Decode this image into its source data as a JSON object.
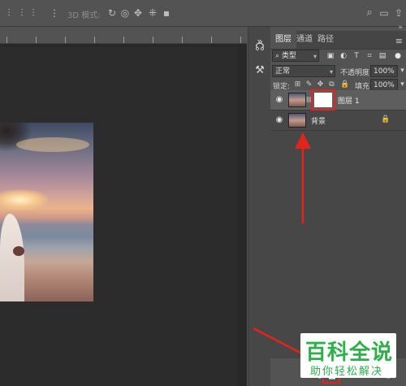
{
  "options_bar": {
    "mode_label": "3D 模式:"
  },
  "panel": {
    "tabs": [
      {
        "label": "图层",
        "active": true
      },
      {
        "label": "通道",
        "active": false
      },
      {
        "label": "路径",
        "active": false
      }
    ],
    "filter": {
      "label": "类型"
    },
    "blend_mode": "正常",
    "opacity_label": "不透明度:",
    "opacity_value": "100%",
    "lock_label": "锁定:",
    "fill_label": "填充:",
    "fill_value": "100%",
    "layers": [
      {
        "name": "图层 1",
        "selected": true,
        "has_mask": true
      },
      {
        "name": "背景",
        "selected": false,
        "locked": true
      }
    ]
  },
  "watermark": {
    "title": "百科全说",
    "subtitle": "助你轻松解决"
  },
  "colors": {
    "highlight": "#e1251b",
    "watermark_green": "#2bb04a"
  }
}
